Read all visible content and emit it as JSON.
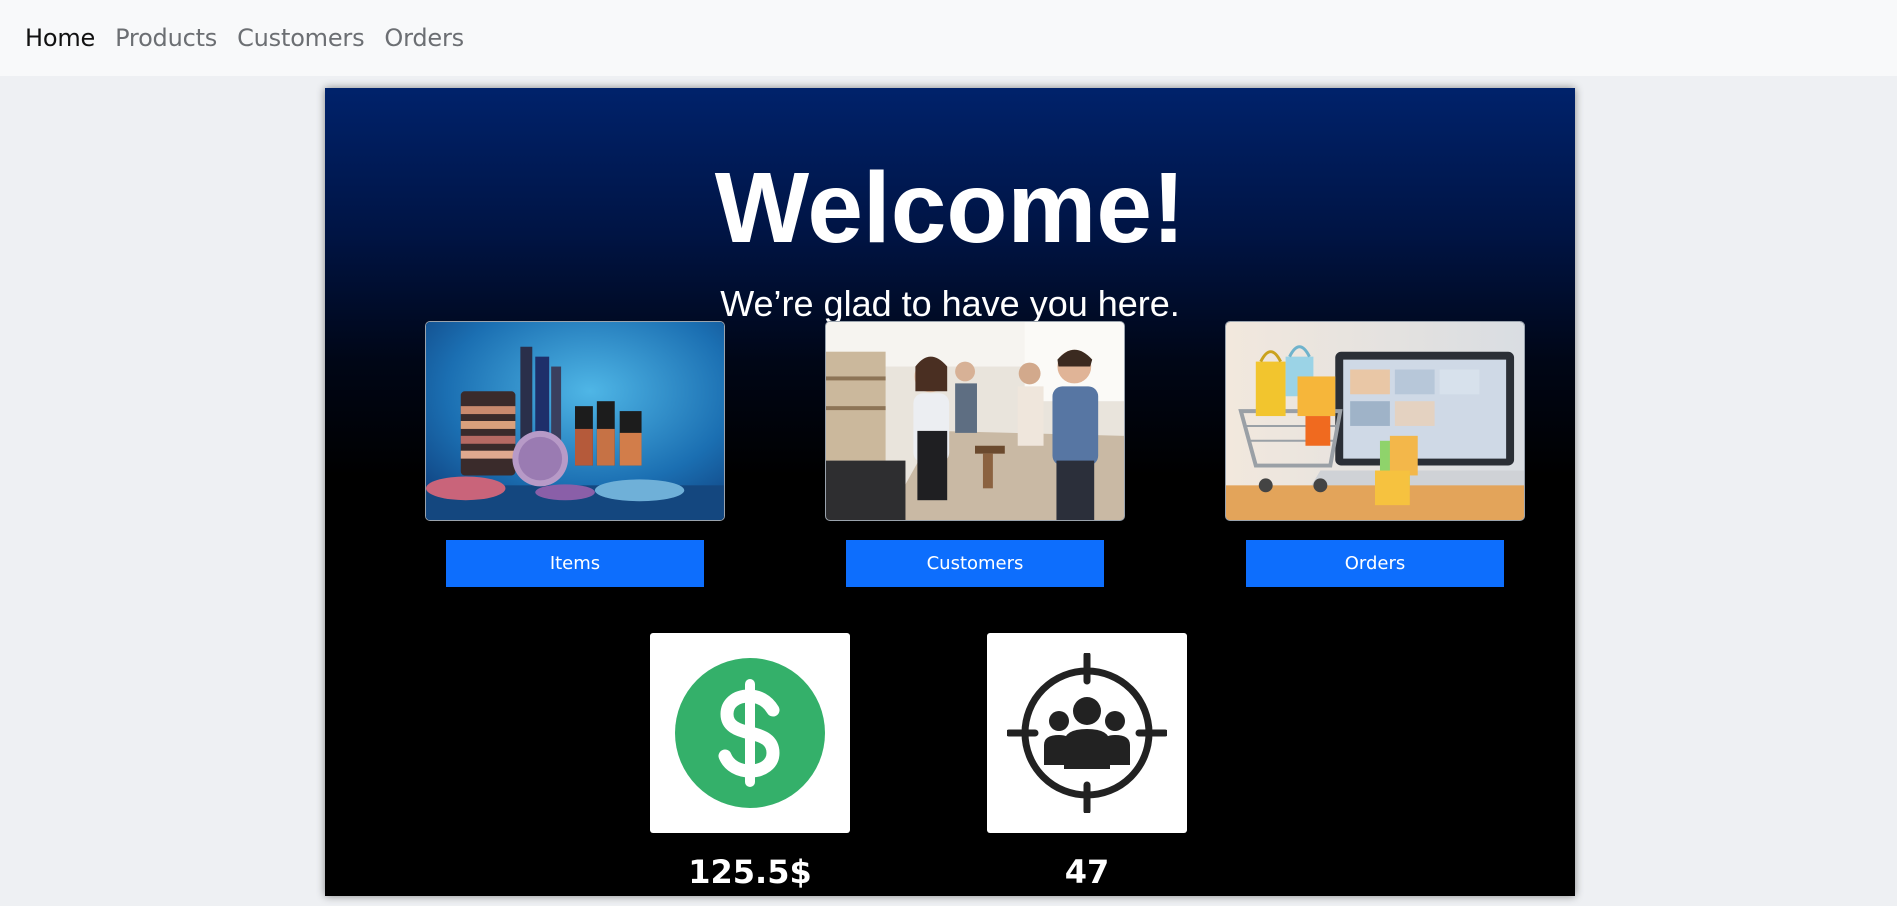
{
  "nav": {
    "items": [
      {
        "label": "Home",
        "active": true
      },
      {
        "label": "Products",
        "active": false
      },
      {
        "label": "Customers",
        "active": false
      },
      {
        "label": "Orders",
        "active": false
      }
    ]
  },
  "hero": {
    "title": "Welcome!",
    "subtitle": "We’re glad to have you here."
  },
  "cards": [
    {
      "image": "cosmetics-products-photo",
      "button_label": "Items"
    },
    {
      "image": "customers-at-counter-photo",
      "button_label": "Customers"
    },
    {
      "image": "shopping-cart-laptop-photo",
      "button_label": "Orders"
    }
  ],
  "stats": [
    {
      "icon": "dollar-icon",
      "value": "125.5$"
    },
    {
      "icon": "target-customers-icon",
      "value": "47"
    }
  ],
  "colors": {
    "nav_bg": "#f8f9fa",
    "page_bg": "#eef0f3",
    "button_blue": "#0d6efd",
    "panel_top": "#00226b",
    "dollar_green": "#34b06a"
  }
}
